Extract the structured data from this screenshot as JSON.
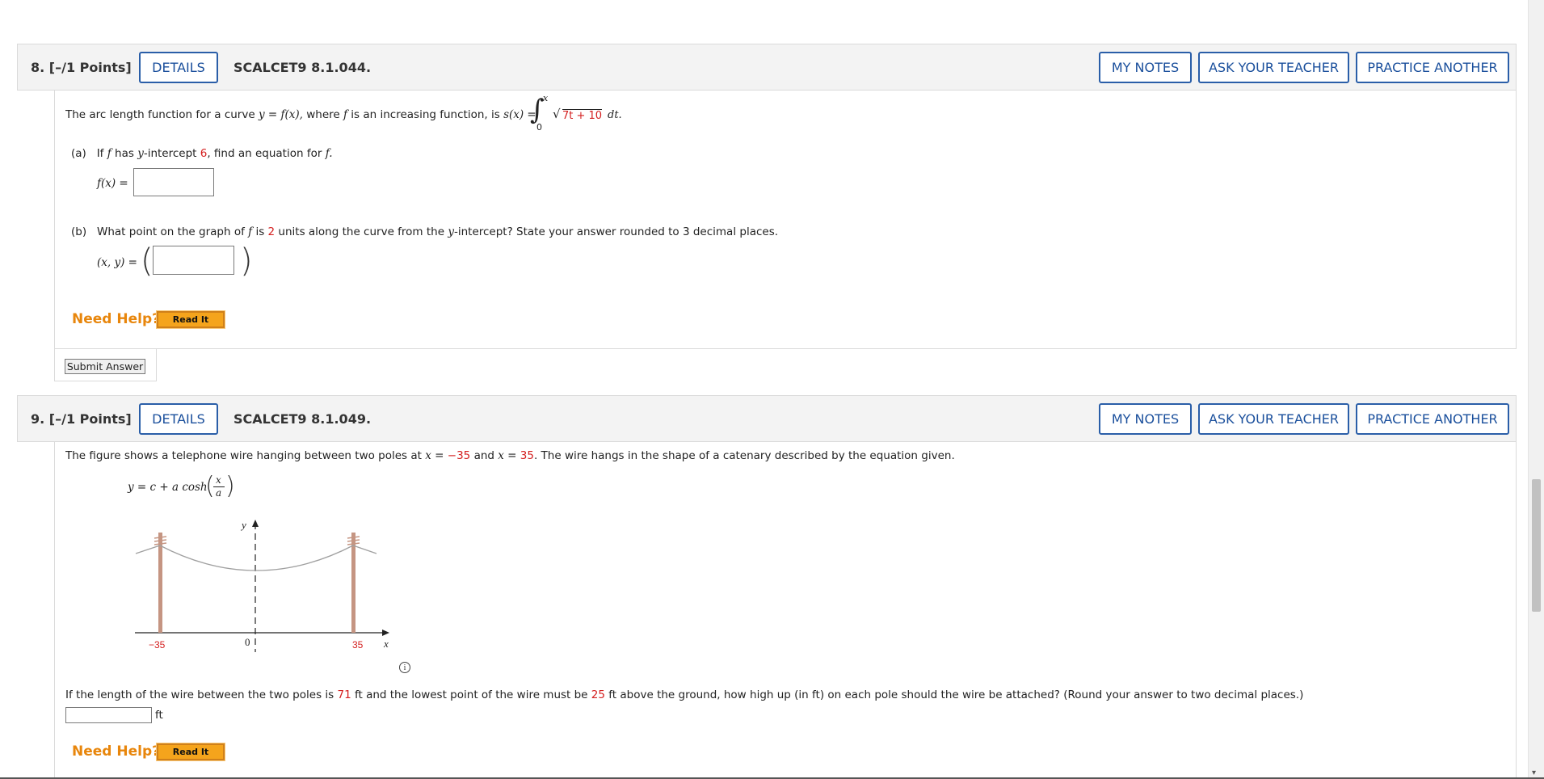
{
  "q8": {
    "number": "8.",
    "points": "[–/1 Points]",
    "details": "DETAILS",
    "code": "SCALCET9 8.1.044.",
    "my_notes": "MY NOTES",
    "ask_teacher": "ASK YOUR TEACHER",
    "practice": "PRACTICE ANOTHER",
    "intro_a": "The arc length function for a curve",
    "intro_b": "y = f(x),",
    "intro_c": "where",
    "intro_d": "f",
    "intro_e": "is an increasing function, is",
    "intro_f": "s(x) =",
    "int_upper": "x",
    "int_lower": "0",
    "radicand": "7t + 10",
    "dt": "dt.",
    "a_label": "(a)",
    "a_text1": "If",
    "a_f": "f",
    "a_text2": "has",
    "a_y": "y",
    "a_text3": "-intercept",
    "a_value": "6",
    "a_text4": ", find an equation for",
    "a_f2": "f.",
    "a_answer_label": "f(x) =",
    "b_label": "(b)",
    "b_text1": "What point on the graph of",
    "b_f": "f",
    "b_text2": "is",
    "b_value": "2",
    "b_text3": "units along the curve from the",
    "b_y": "y",
    "b_text4": "-intercept? State your answer rounded to 3 decimal places.",
    "b_answer_label": "(x, y) =",
    "need_help": "Need Help?",
    "read_it": "Read It",
    "submit": "Submit Answer"
  },
  "q9": {
    "number": "9.",
    "points": "[–/1 Points]",
    "details": "DETAILS",
    "code": "SCALCET9 8.1.049.",
    "my_notes": "MY NOTES",
    "ask_teacher": "ASK YOUR TEACHER",
    "practice": "PRACTICE ANOTHER",
    "intro1": "The figure shows a telephone wire hanging between two poles at",
    "x1": "x = ",
    "v1": "−35",
    "and": "and",
    "x2": "x = ",
    "v2": "35",
    "intro2": ". The wire hangs in the shape of a catenary described by the equation given.",
    "eq_lhs": "y = c + a cosh",
    "eq_num": "x",
    "eq_den": "a",
    "fig_y": "y",
    "fig_x": "x",
    "fig_zero": "0",
    "fig_left": "−35",
    "fig_right": "35",
    "info_icon": "i",
    "p1": "If the length of the wire between the two poles is",
    "len": "71",
    "p2": "ft and the lowest point of the wire must be",
    "low": "25",
    "p3": "ft above the ground, how high up (in ft) on each pole should the wire be attached? (Round your answer to two decimal places.)",
    "unit": "ft",
    "need_help": "Need Help?",
    "read_it": "Read It"
  },
  "colors": {
    "accent": "#2a5ea8",
    "highlight": "#d42020",
    "help": "#e8860c",
    "readit": "#f5a41c",
    "pole": "#c59582"
  },
  "icons": [
    "info-icon",
    "scrollbar-down-arrow-icon"
  ]
}
